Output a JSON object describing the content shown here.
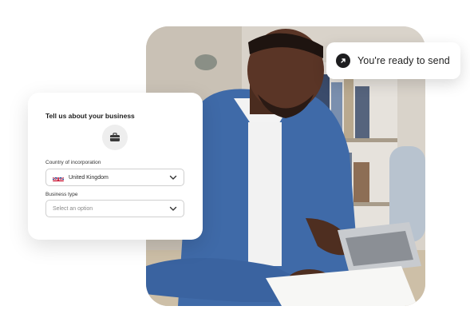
{
  "toast": {
    "message": "You're ready to send",
    "icon": "arrow-up-right-icon"
  },
  "form": {
    "title": "Tell us about your business",
    "header_icon": "briefcase-icon",
    "country": {
      "label": "Country of incorporation",
      "value": "United Kingdom",
      "flag_icon": "uk-flag-icon"
    },
    "business_type": {
      "label": "Business type",
      "placeholder": "Select an option"
    }
  },
  "photo": {
    "description_icon": "photo-person-laptop"
  },
  "colors": {
    "shirt": "#3f6aa8",
    "dark": "#1d1d1f",
    "card_bg": "#ffffff"
  }
}
